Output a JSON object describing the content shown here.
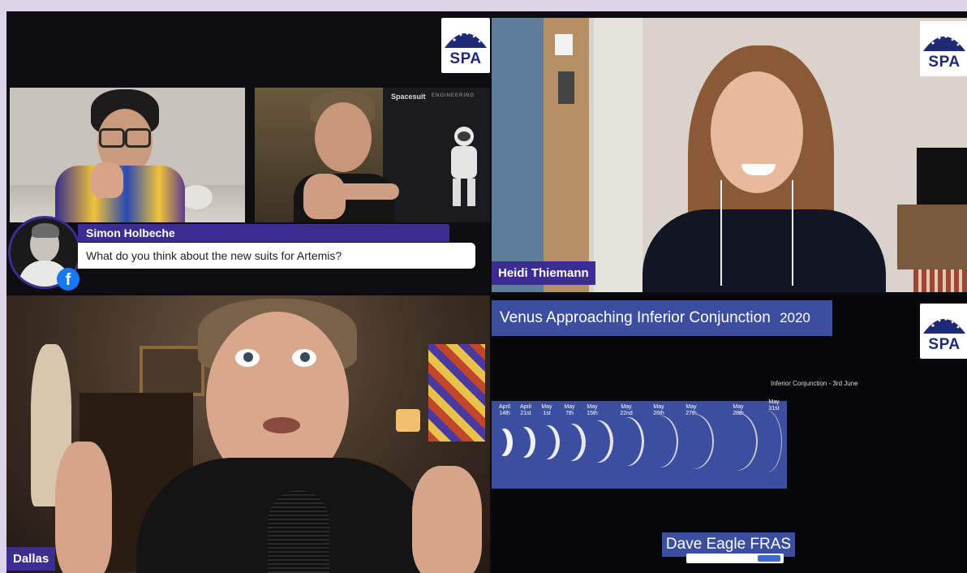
{
  "brand": {
    "logo_text": "SPA"
  },
  "comment": {
    "author": "Simon Holbeche",
    "text": "What do you think about the new suits for Artemis?"
  },
  "participants": {
    "heidi": "Heidi Thiemann",
    "dallas": "Dallas",
    "dave": "Dave Eagle FRAS"
  },
  "slide": {
    "title": "Venus Approaching Inferior Conjunction",
    "year": "2020",
    "annotation": "Inferior Conjunction - 3rd June",
    "months": [
      "April 14th",
      "April 21st",
      "May 1st",
      "May 7th",
      "May 15th",
      "May 22nd",
      "May 26th",
      "May 27th",
      "May 28th",
      "May 31st"
    ]
  },
  "poster": {
    "heading": "Spacesuit",
    "subheading": "ENGINEERING"
  },
  "colors": {
    "accent": "#3b2d91",
    "slide_panel": "#3c4ea0",
    "background": "#ddd3e8"
  },
  "icons": {
    "social": "facebook-icon"
  }
}
